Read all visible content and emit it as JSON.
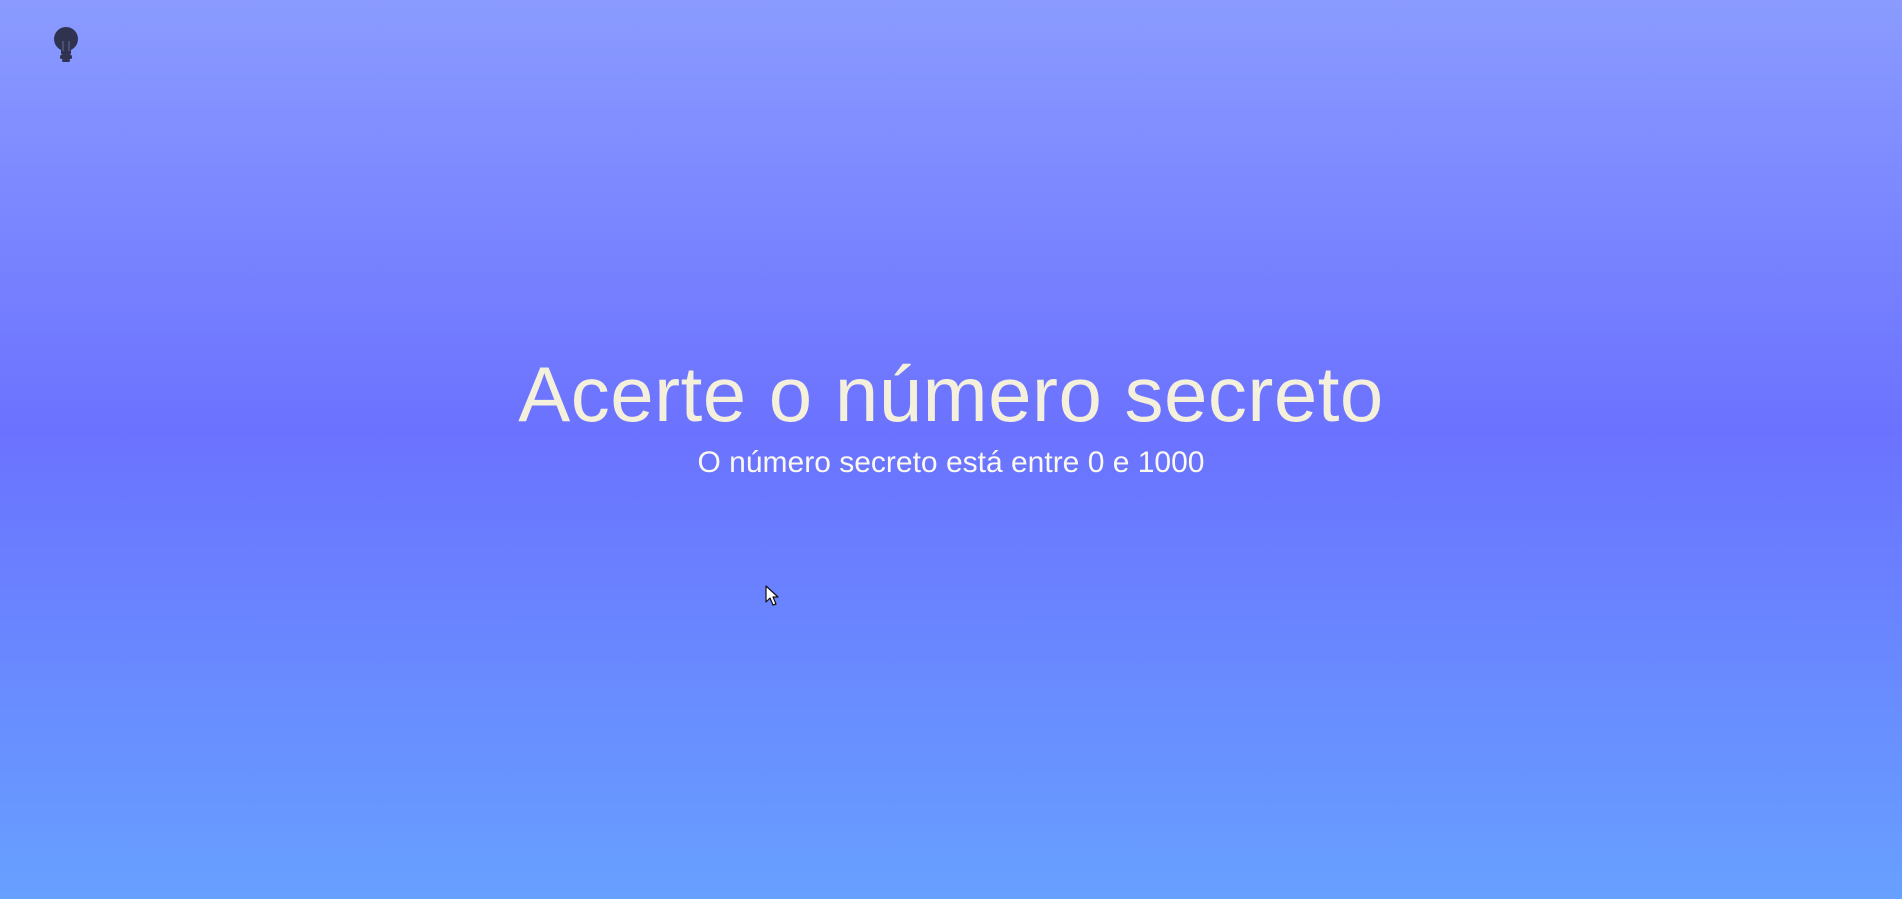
{
  "header": {
    "theme_toggle_icon": "lightbulb-icon"
  },
  "main": {
    "title": "Acerte o número secreto",
    "subtitle": "O número secreto está entre 0 e 1000"
  },
  "colors": {
    "background_top": "#8a9bff",
    "background_middle": "#6b72ff",
    "background_bottom": "#67a0ff",
    "title_text": "#f4f0dc",
    "icon": "#2f3350"
  },
  "overlay": {
    "cursor_icon": "mouse-pointer-icon"
  }
}
